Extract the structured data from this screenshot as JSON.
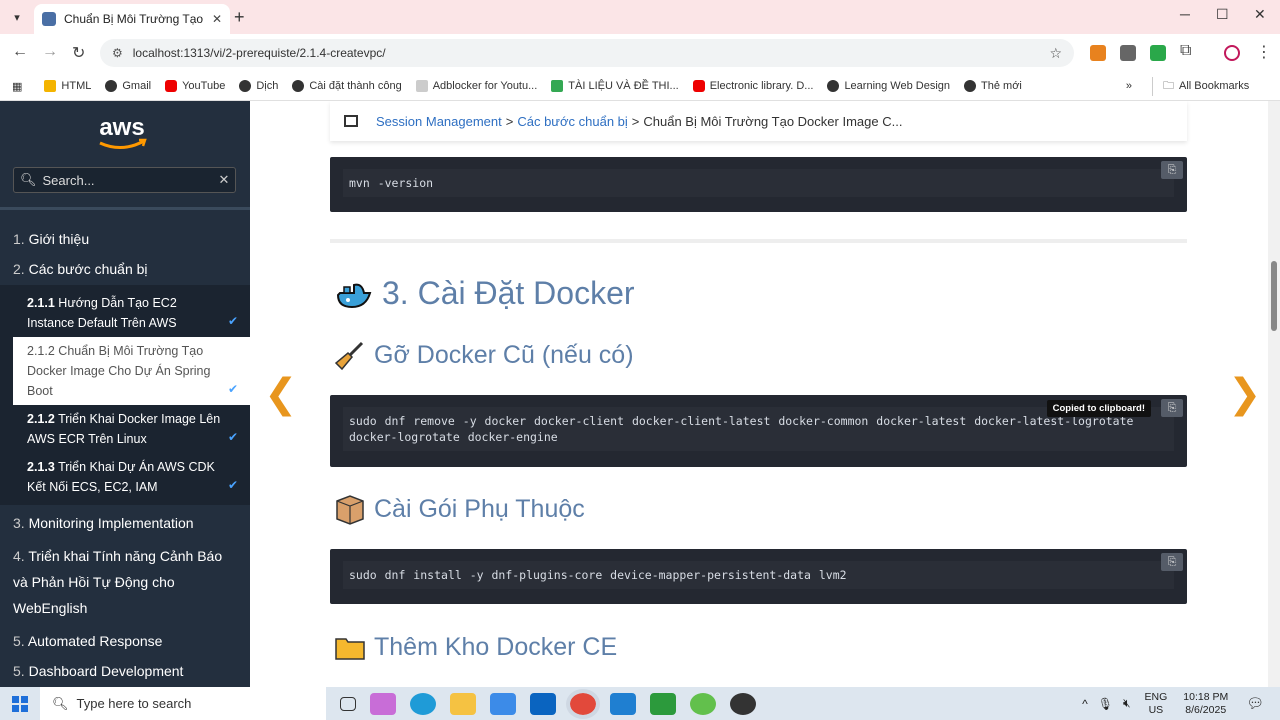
{
  "browser": {
    "tab_title": "Chuẩn Bị Môi Trường Tạo Docker",
    "url": "localhost:1313/vi/2-prerequiste/2.1.4-createvpc/",
    "bookmarks": [
      "HTML",
      "Gmail",
      "YouTube",
      "Dịch",
      "Cài đặt thành công",
      "Adblocker for Youtu...",
      "TÀI LIỆU VÀ ĐỀ THI...",
      "Electronic library. D...",
      "Learning Web Design",
      "Thẻ mới"
    ],
    "all_bookmarks": "All Bookmarks"
  },
  "sidebar": {
    "logo_text": "aws",
    "search_placeholder": "Search...",
    "items": [
      {
        "num": "1.",
        "label": "Giới thiệu"
      },
      {
        "num": "2.",
        "label": "Các bước chuẩn bị"
      },
      {
        "num": "3.",
        "label": "Monitoring Implementation"
      },
      {
        "num": "4.",
        "label": "Triển khai Tính năng Cảnh Báo và Phản Hồi Tự Động cho WebEnglish"
      },
      {
        "num": "5.",
        "label": "Automated Response"
      },
      {
        "num": "5.",
        "label": "Dashboard Development"
      }
    ],
    "subitems": [
      {
        "num": "2.1.1",
        "label": "Hướng Dẫn Tạo EC2 Instance Default Trên AWS"
      },
      {
        "num": "2.1.2",
        "label": "Chuẩn Bị Môi Trường Tạo Docker Image Cho Dự Án Spring Boot"
      },
      {
        "num": "2.1.2",
        "label": "Triển Khai Docker Image Lên AWS ECR Trên Linux"
      },
      {
        "num": "2.1.3",
        "label": "Triển Khai Dự Án AWS CDK Kết Nối ECS, EC2, IAM"
      }
    ]
  },
  "main": {
    "breadcrumb": {
      "crumb1": "Session Management",
      "crumb2": "Các bước chuẩn bị",
      "current": "Chuẩn Bị Môi Trường Tạo Docker Image C...",
      "separator": ">"
    },
    "code1": "mvn -version",
    "section_title": "3. Cài Đặt Docker",
    "sub1": "Gỡ Docker Cũ (nếu có)",
    "code2": "sudo dnf remove -y docker docker-client docker-client-latest docker-common docker-latest docker-latest-logrotate docker-logrotate docker-engine",
    "tooltip": "Copied to clipboard!",
    "sub2": "Cài Gói Phụ Thuộc",
    "code3": "sudo dnf install -y dnf-plugins-core device-mapper-persistent-data lvm2",
    "sub3": "Thêm Kho Docker CE"
  },
  "taskbar": {
    "search_placeholder": "Type here to search",
    "lang1": "ENG",
    "lang2": "US",
    "time": "10:18 PM",
    "date": "8/6/2025"
  }
}
